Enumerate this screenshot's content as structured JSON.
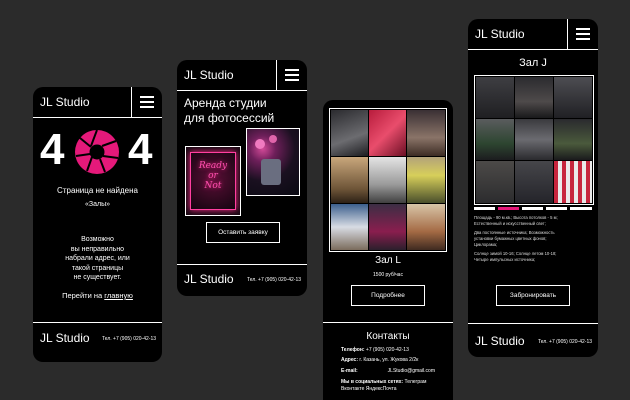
{
  "brand": "JL Studio",
  "footer_phone": "Тел. +7 (905) 020-42-13",
  "screen404": {
    "code_left": "4",
    "code_right": "4",
    "title": "Страница не найдена",
    "section": "«Залы»",
    "message": [
      "Возможно",
      "вы неправильно",
      "набрали адрес, или",
      "такой страницы",
      "не существует."
    ],
    "goto_prefix": "Перейти на",
    "goto_link": "главную"
  },
  "screen_rent": {
    "heading_line1": "Аренда студии",
    "heading_line2": "для фотосессий",
    "neon_line1": "Ready",
    "neon_line2": "or",
    "neon_line3": "Not",
    "button": "Оставить заявку"
  },
  "screen_hall_l": {
    "title": "Зал L",
    "price": "1500 руб/час",
    "button": "Подробнее",
    "contacts_title": "Контакты",
    "contacts": [
      {
        "label": "Телефон:",
        "value": "+7 (905) 020-42-13"
      },
      {
        "label": "Адрес:",
        "value": "г. Казань, ул. Жукова 2/2к"
      },
      {
        "label": "E-mail:",
        "value": "JLStudio@gmail.com"
      },
      {
        "label": "Мы в социальных сетях:",
        "value": "Телеграм"
      },
      {
        "label": "",
        "value": "Вконтакте ЯндексПочта"
      }
    ]
  },
  "screen_hall_j": {
    "title": "Зал J",
    "desc": [
      "Площадь - 90 м.кв.; Высота потолков - 5 м;",
      "Естественный и искусственный свет;",
      "Два постоянные источника; Возможность",
      "установки бумажных цветных фонов;",
      "Циклорама;",
      "Солнце зимой 10-16; Солнце летом 10-18;",
      "Четыре импульсных источника;"
    ],
    "button": "Забронировать"
  },
  "colors": {
    "accent": "#e5197a",
    "background": "#2b2b2b",
    "panel": "#000000"
  }
}
